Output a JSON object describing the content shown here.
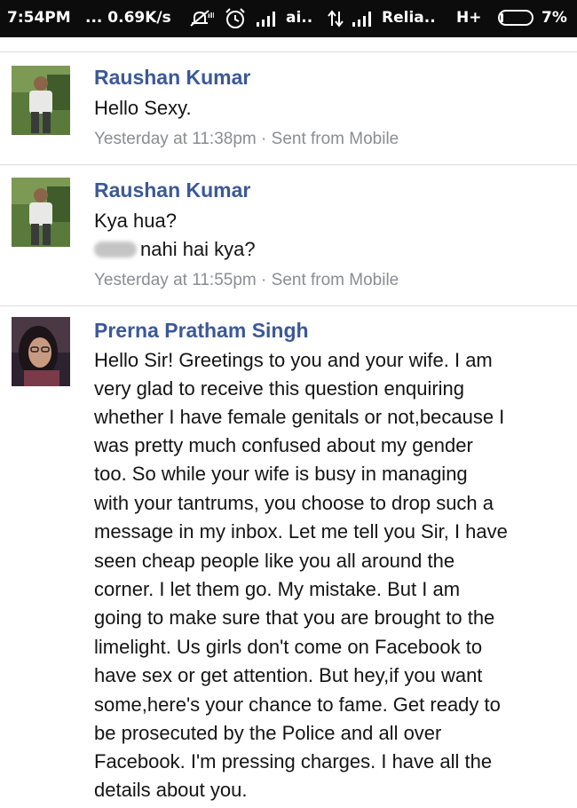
{
  "status_bar": {
    "time": "7:54PM",
    "speed": "... 0.69K/s",
    "carrier1": "ai..",
    "carrier2": "Relia..",
    "network": "H+",
    "battery": "7%",
    "icons": [
      "mute-icon",
      "alarm-icon",
      "signal-icon",
      "data-arrows-icon",
      "battery-icon"
    ]
  },
  "messages": [
    {
      "sender": "Raushan Kumar",
      "lines": [
        "Hello Sexy."
      ],
      "timestamp": "Yesterday at 11:38pm",
      "via": "Sent from Mobile"
    },
    {
      "sender": "Raushan Kumar",
      "lines": [
        "Kya hua?",
        "nahi hai kya?"
      ],
      "timestamp": "Yesterday at 11:55pm",
      "via": "Sent from Mobile"
    },
    {
      "sender": "Prerna Pratham Singh",
      "lines": [
        "Hello Sir! Greetings to you and your wife. I am",
        "very glad to receive this question enquiring",
        "whether I have female genitals or not,because I",
        "was pretty much confused about my gender",
        "too. So while your wife is busy in managing",
        "with your tantrums, you choose to drop such a",
        "message in my inbox. Let me tell you Sir, I have",
        "seen cheap people like you all around the",
        "corner. I let them go. My mistake. But I am",
        "going to make sure that you are brought to the",
        "limelight. Us girls don't come on Facebook to",
        "have sex or get attention. But hey,if you want",
        "some,here's your chance to fame. Get ready to",
        "be prosecuted by the Police and all over",
        "Facebook. I'm pressing charges. I have all the",
        "details about you."
      ]
    }
  ],
  "colors": {
    "name": "#3b5998",
    "meta": "#8a8d91",
    "status_bg": "#0c0c0c"
  }
}
